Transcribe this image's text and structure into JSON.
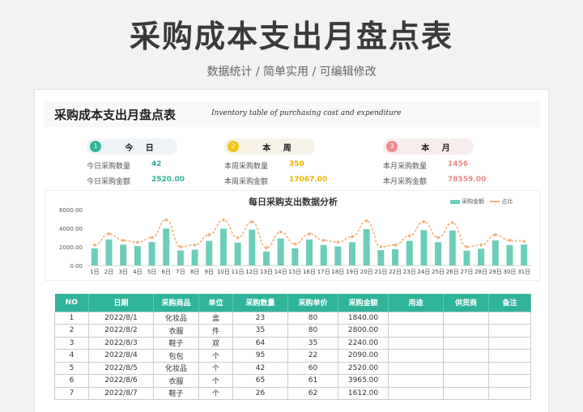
{
  "page": {
    "title": "采购成本支出月盘点表",
    "subtitle": "数据统计 / 简单实用 / 可编辑修改"
  },
  "sheet": {
    "title": "采购成本支出月盘点表",
    "subtitle": "Inventory table of purchasing cost and expenditure"
  },
  "summary": {
    "today": {
      "badge": "1",
      "label": "今 日",
      "qty_label": "今日采购数量",
      "qty": "42",
      "amt_label": "今日采购金额",
      "amt": "2520.00",
      "color": "#2fb49a"
    },
    "week": {
      "badge": "2",
      "label": "本 周",
      "qty_label": "本周采购数量",
      "qty": "350",
      "amt_label": "本周采购金额",
      "amt": "17067.00",
      "color": "#f5c518"
    },
    "month": {
      "badge": "3",
      "label": "本 月",
      "qty_label": "本月采购数量",
      "qty": "1456",
      "amt_label": "本月采购金额",
      "amt": "78559.00",
      "color": "#ef8c8c"
    }
  },
  "chart_data": {
    "type": "bar",
    "title": "每日采购支出数据分析",
    "series": [
      {
        "name": "采购金额",
        "type": "bar",
        "color": "#6ccdb9",
        "values": [
          1840,
          2800,
          2240,
          2090,
          2520,
          3965,
          1612,
          1700,
          2650,
          3950,
          2450,
          3850,
          1500,
          2900,
          1850,
          2800,
          2200,
          2050,
          2500,
          3900,
          1650,
          1750,
          2650,
          3800,
          2500,
          3750,
          1600,
          1800,
          2700,
          2200,
          2250
        ]
      },
      {
        "name": "占比",
        "type": "line",
        "color": "#f2b27a",
        "values": [
          2200,
          3400,
          2700,
          2500,
          3000,
          4900,
          2000,
          2200,
          3300,
          4900,
          3000,
          4700,
          1900,
          3600,
          2300,
          3400,
          2700,
          2500,
          3100,
          4800,
          2000,
          2200,
          3200,
          4700,
          3000,
          4600,
          2000,
          2200,
          3300,
          2700,
          2600
        ]
      }
    ],
    "categories": [
      "1日",
      "2日",
      "3日",
      "4日",
      "5日",
      "6日",
      "7日",
      "8日",
      "9日",
      "10日",
      "11日",
      "12日",
      "13日",
      "14日",
      "15日",
      "16日",
      "17日",
      "18日",
      "19日",
      "20日",
      "21日",
      "22日",
      "23日",
      "24日",
      "25日",
      "26日",
      "27日",
      "28日",
      "29日",
      "30日",
      "31日"
    ],
    "y_ticks": [
      "0.00",
      "2000.00",
      "4000.00",
      "6000.00"
    ],
    "ylim": [
      0,
      6000
    ],
    "grid": false,
    "legend_position": "top-right"
  },
  "table": {
    "columns": [
      "NO",
      "日期",
      "采购商品",
      "单位",
      "采购数量",
      "采购单价",
      "采购金额",
      "用途",
      "供货商",
      "备注"
    ],
    "rows": [
      [
        "1",
        "2022/8/1",
        "化妆品",
        "盒",
        "23",
        "80",
        "1840.00",
        "",
        "",
        ""
      ],
      [
        "2",
        "2022/8/2",
        "衣服",
        "件",
        "35",
        "80",
        "2800.00",
        "",
        "",
        ""
      ],
      [
        "3",
        "2022/8/3",
        "鞋子",
        "双",
        "64",
        "35",
        "2240.00",
        "",
        "",
        ""
      ],
      [
        "4",
        "2022/8/4",
        "包包",
        "个",
        "95",
        "22",
        "2090.00",
        "",
        "",
        ""
      ],
      [
        "5",
        "2022/8/5",
        "化妆品",
        "个",
        "42",
        "60",
        "2520.00",
        "",
        "",
        ""
      ],
      [
        "6",
        "2022/8/6",
        "衣服",
        "个",
        "65",
        "61",
        "3965.00",
        "",
        "",
        ""
      ],
      [
        "7",
        "2022/8/7",
        "鞋子",
        "个",
        "26",
        "62",
        "1612.00",
        "",
        "",
        ""
      ]
    ]
  }
}
